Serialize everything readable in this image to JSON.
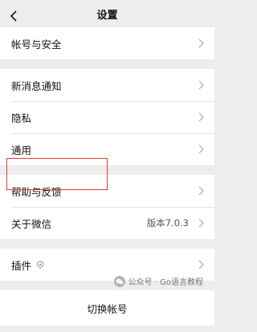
{
  "nav": {
    "title": "设置",
    "back_icon": "chevron-left-icon"
  },
  "sections": [
    {
      "items": [
        {
          "id": "account-security",
          "label": "帐号与安全"
        }
      ]
    },
    {
      "items": [
        {
          "id": "new-message-notify",
          "label": "新消息通知"
        },
        {
          "id": "privacy",
          "label": "隐私"
        },
        {
          "id": "general",
          "label": "通用"
        }
      ]
    },
    {
      "items": [
        {
          "id": "help-feedback",
          "label": "帮助与反馈"
        },
        {
          "id": "about-wechat",
          "label": "关于微信",
          "value": "版本7.0.3"
        }
      ]
    },
    {
      "items": [
        {
          "id": "plugins",
          "label": "插件",
          "icon": "shield-icon"
        }
      ]
    }
  ],
  "switch_account": "切换帐号",
  "watermark": {
    "text": "公众号 · Go语言教程",
    "icon": "wechat-logo-icon"
  },
  "colors": {
    "background": "#ededed",
    "cell": "#ffffff",
    "highlight": "#e03c3c"
  }
}
